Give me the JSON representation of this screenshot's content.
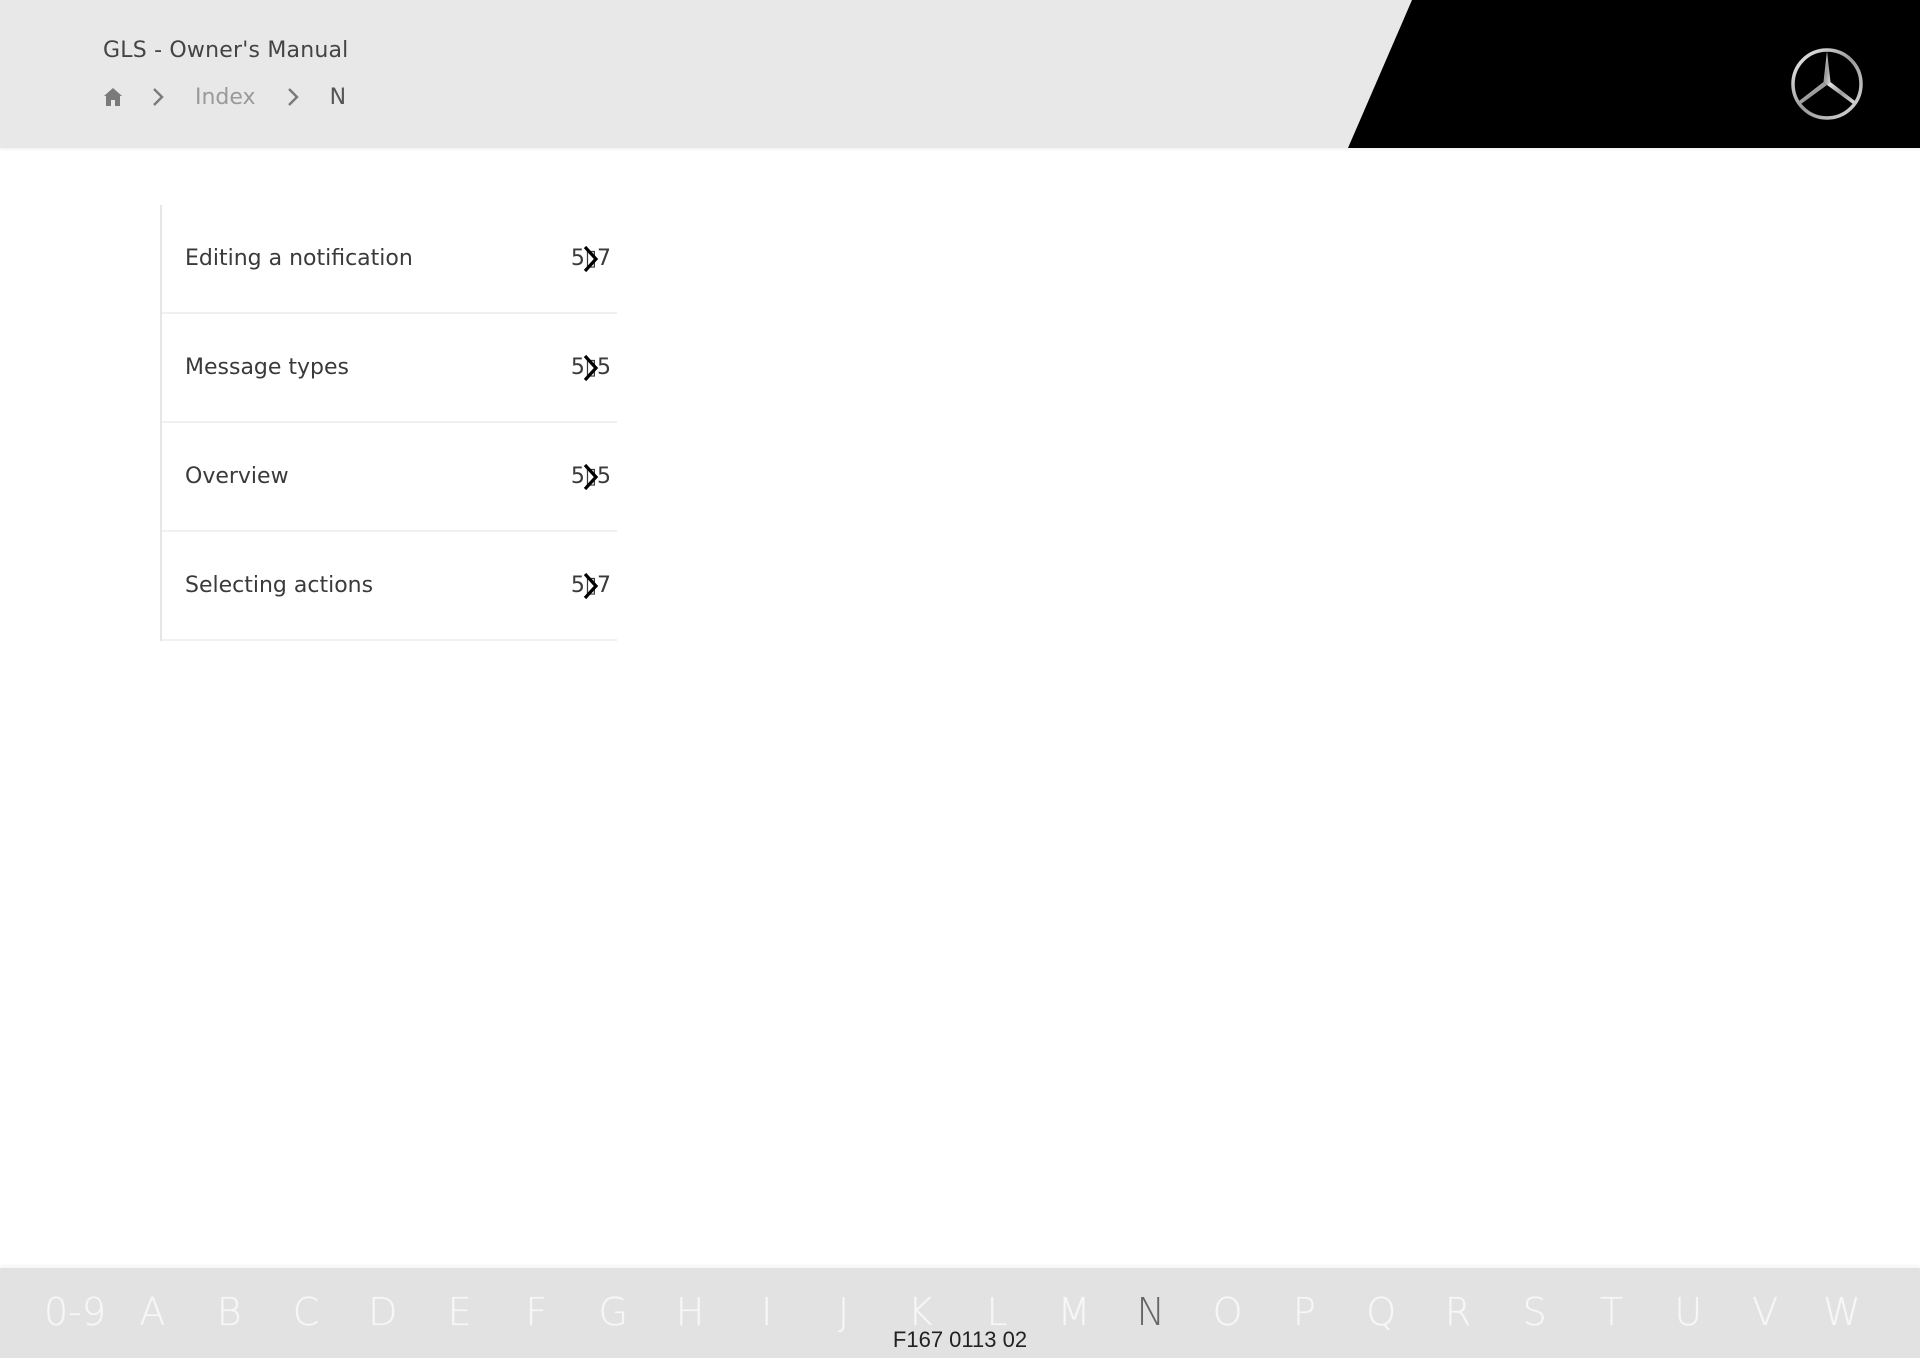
{
  "header": {
    "title": "GLS - Owner's Manual",
    "logo_icon": "mercedes-star-icon",
    "breadcrumb": {
      "home_icon": "home-icon",
      "separator_icon": "chevron-right-icon",
      "items": [
        {
          "label": "Index"
        },
        {
          "label": "N"
        }
      ]
    }
  },
  "index_list": {
    "items": [
      {
        "label": "Editing a notification",
        "page": "5▯7",
        "chevron_icon": "chevron-right-icon"
      },
      {
        "label": "Message types",
        "page": "5▯5",
        "chevron_icon": "chevron-right-icon"
      },
      {
        "label": "Overview",
        "page": "5▯5",
        "chevron_icon": "chevron-right-icon"
      },
      {
        "label": "Selecting actions",
        "page": "5▯7",
        "chevron_icon": "chevron-right-icon"
      }
    ]
  },
  "alphabet_bar": {
    "active": "N",
    "letters": [
      "0-9",
      "A",
      "B",
      "C",
      "D",
      "E",
      "F",
      "G",
      "H",
      "I",
      "J",
      "K",
      "L",
      "M",
      "N",
      "O",
      "P",
      "Q",
      "R",
      "S",
      "T",
      "U",
      "V",
      "W"
    ]
  },
  "figure_id": "F167 0113 02",
  "colors": {
    "header_bg": "#e8e8e8",
    "brand_panel": "#000000",
    "alpha_bar_bg": "#e2e2e2",
    "active_letter": "#666666",
    "inactive_letter": "#f7f7f7"
  }
}
